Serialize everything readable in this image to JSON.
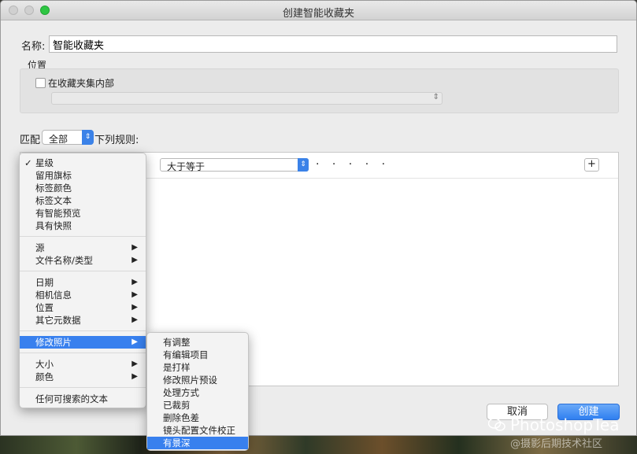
{
  "window": {
    "title": "创建智能收藏夹"
  },
  "name": {
    "label": "名称:",
    "value": "智能收藏夹"
  },
  "location": {
    "label": "位置",
    "checkbox_label": "在收藏夹集内部",
    "checked": false
  },
  "match": {
    "prefix": "匹配",
    "selected": "全部",
    "suffix": "下列规则:"
  },
  "rule": {
    "operator": "大于等于",
    "stars": "· · · · ·",
    "add_label": "+"
  },
  "buttons": {
    "cancel": "取消",
    "create": "创建"
  },
  "field_menu": {
    "items": [
      {
        "label": "星级",
        "checked": true
      },
      {
        "label": "留用旗标"
      },
      {
        "label": "标签颜色"
      },
      {
        "label": "标签文本"
      },
      {
        "label": "有智能预览"
      },
      {
        "label": "具有快照"
      },
      {
        "label": "源",
        "submenu": true
      },
      {
        "label": "文件名称/类型",
        "submenu": true
      },
      {
        "label": "日期",
        "submenu": true
      },
      {
        "label": "相机信息",
        "submenu": true
      },
      {
        "label": "位置",
        "submenu": true
      },
      {
        "label": "其它元数据",
        "submenu": true
      },
      {
        "label": "修改照片",
        "submenu": true,
        "highlighted": true
      },
      {
        "label": "大小",
        "submenu": true
      },
      {
        "label": "颜色",
        "submenu": true
      },
      {
        "label": "任何可搜索的文本"
      }
    ]
  },
  "sub_menu": {
    "items": [
      {
        "label": "有调整"
      },
      {
        "label": "有编辑项目"
      },
      {
        "label": "是打样"
      },
      {
        "label": "修改照片预设"
      },
      {
        "label": "处理方式"
      },
      {
        "label": "已裁剪"
      },
      {
        "label": "删除色差"
      },
      {
        "label": "镜头配置文件校正"
      },
      {
        "label": "有景深",
        "highlighted": true
      }
    ]
  },
  "watermark": {
    "text": "PhotoshopTea",
    "sub": "@摄影后期技术社区"
  },
  "colors": {
    "accent": "#3880ee",
    "create_button": "#2f7ff0",
    "close_button": "#2ec643"
  }
}
